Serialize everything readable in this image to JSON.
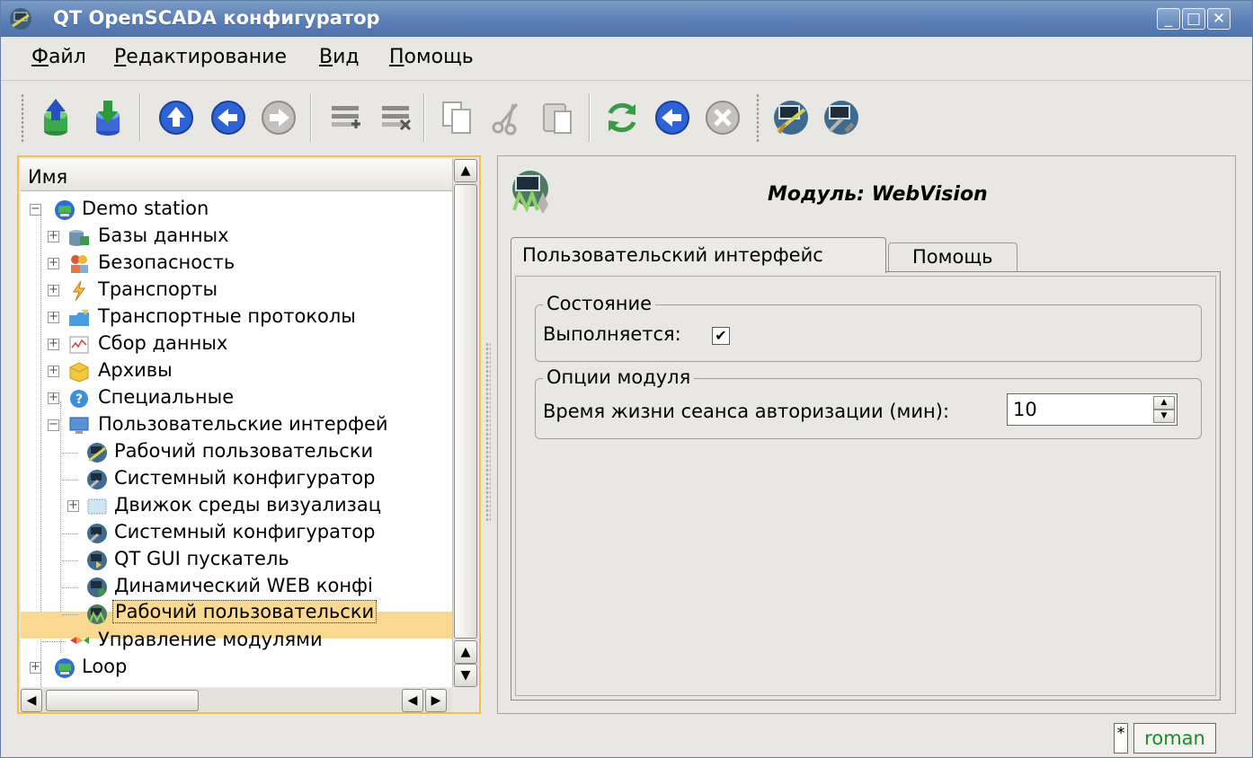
{
  "window": {
    "title": "QT OpenSCADA конфигуратор",
    "buttons": [
      "minimize",
      "maximize",
      "close"
    ]
  },
  "menubar": [
    {
      "underline": "Ф",
      "rest": "айл"
    },
    {
      "underline": "Р",
      "rest": "едактирование"
    },
    {
      "underline": "В",
      "rest": "ид"
    },
    {
      "underline": "П",
      "rest": "омощь"
    }
  ],
  "toolbar": {
    "buttons": [
      "db-load-icon",
      "db-save-icon",
      "go-up-icon",
      "go-back-icon",
      "go-forward-icon",
      "add-item-icon",
      "delete-item-icon",
      "copy-icon",
      "cut-icon",
      "paste-icon",
      "refresh-icon",
      "start-icon",
      "stop-icon",
      "vision-icon",
      "system-config-icon"
    ]
  },
  "tree": {
    "header": "Имя",
    "items": [
      {
        "label": "Demo station",
        "icon": "station-icon"
      },
      {
        "label": "Базы данных",
        "icon": "database-icon"
      },
      {
        "label": "Безопасность",
        "icon": "security-icon"
      },
      {
        "label": "Транспорты",
        "icon": "transport-icon"
      },
      {
        "label": "Транспортные протоколы",
        "icon": "protocol-icon"
      },
      {
        "label": "Сбор данных",
        "icon": "data-acquisition-icon"
      },
      {
        "label": "Архивы",
        "icon": "archive-icon"
      },
      {
        "label": "Специальные",
        "icon": "special-icon"
      },
      {
        "label": "Пользовательские интерфей",
        "icon": "ui-icon"
      },
      {
        "label": "Рабочий пользовательски",
        "icon": "vision-icon"
      },
      {
        "label": "Системный конфигуратор",
        "icon": "config-icon"
      },
      {
        "label": "Движок среды визуализац",
        "icon": "vca-engine-icon"
      },
      {
        "label": "Системный конфигуратор",
        "icon": "config-icon"
      },
      {
        "label": "QT GUI пускатель",
        "icon": "qt-starter-icon"
      },
      {
        "label": "Динамический WEB конфі",
        "icon": "web-config-icon"
      },
      {
        "label": "Рабочий пользовательски",
        "icon": "webvision-icon"
      },
      {
        "label": "Управление модулями",
        "icon": "modules-icon"
      },
      {
        "label": "Loop",
        "icon": "station-icon"
      }
    ]
  },
  "module": {
    "title": "Модуль: WebVision",
    "icon": "webvision-icon",
    "tabs": [
      {
        "label": "Пользовательский интерфейс",
        "active": true
      },
      {
        "label": "Помощь",
        "active": false
      }
    ],
    "state_group": {
      "title": "Состояние",
      "running_label": "Выполняется:",
      "running": true
    },
    "options_group": {
      "title": "Опции модуля",
      "session_label": "Время жизни сеанса авторизации (мин):",
      "session_value": "10"
    }
  },
  "status": {
    "modified": "*",
    "user": "roman"
  }
}
